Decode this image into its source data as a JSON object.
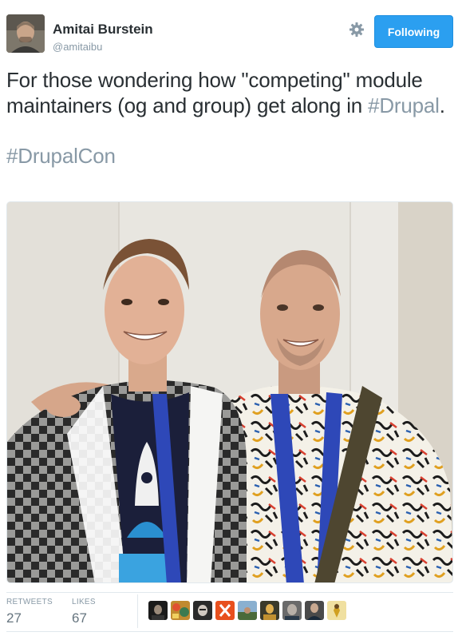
{
  "user": {
    "name": "Amitai Burstein",
    "handle": "@amitaibu"
  },
  "header": {
    "follow_label": "Following"
  },
  "tweet": {
    "line1": "For those wondering how \"competing\" module maintainers (og and group) get along in ",
    "hashtag1": "#Drupal",
    "line1_end": ".",
    "hashtag2": "#DrupalCon"
  },
  "stats": {
    "retweets_label": "RETWEETS",
    "retweets_value": "27",
    "likes_label": "LIKES",
    "likes_value": "67"
  },
  "likers": [
    {
      "icon": "avatar-dark-portrait"
    },
    {
      "icon": "avatar-colorful-pattern"
    },
    {
      "icon": "avatar-dark-face"
    },
    {
      "icon": "avatar-orange-logo"
    },
    {
      "icon": "avatar-landscape"
    },
    {
      "icon": "avatar-person-yellow"
    },
    {
      "icon": "avatar-gray-face"
    },
    {
      "icon": "avatar-person-suit"
    },
    {
      "icon": "avatar-yellow-figure"
    }
  ],
  "colors": {
    "accent": "#2b9ff0",
    "hashtag": "#8899a6",
    "text": "#292f33"
  }
}
